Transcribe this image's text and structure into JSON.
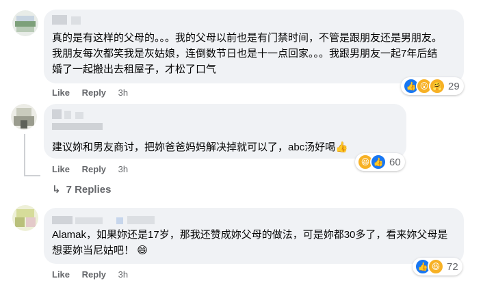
{
  "comments": [
    {
      "text": "真的是有这样的父母的。。。我的父母以前也是有门禁时间，不管是跟朋友还是男朋友。我朋友每次都笑我是灰姑娘，连倒数节日也是十一点回家。。。我跟男朋友一起7年后结婚了一起搬出去租屋子，才松了口气",
      "like": "Like",
      "reply": "Reply",
      "time": "3h",
      "reaction_count": "29"
    },
    {
      "text": "建议妳和男友商讨，把妳爸爸妈妈解决掉就可以了，abc汤好喝",
      "like": "Like",
      "reply": "Reply",
      "time": "3h",
      "reaction_count": "60"
    },
    {
      "text": "Alamak，如果妳还是17岁，那我还赞成妳父母的做法，可是妳都30多了，看来妳父母是想要妳当尼姑吧！",
      "like": "Like",
      "reply": "Reply",
      "time": "3h",
      "reaction_count": "72"
    }
  ],
  "thread": {
    "replies_label": "7 Replies",
    "arrow": "↳"
  },
  "emoji": {
    "thumb": "👍",
    "grin": "😄",
    "wow": "😮",
    "laugh": "😆",
    "care": "🤗"
  },
  "colors": {
    "bubble": "#f0f2f5",
    "muted": "#65676b",
    "like_blue": "#1877f2",
    "haha_yellow": "#f7b125"
  }
}
